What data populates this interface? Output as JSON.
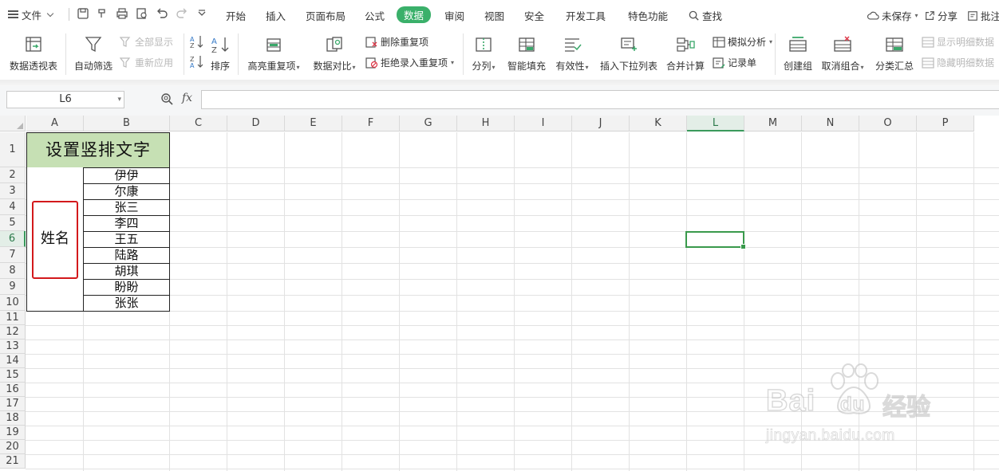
{
  "menu": {
    "file_label": "文件",
    "tabs": [
      "开始",
      "插入",
      "页面布局",
      "公式",
      "数据",
      "审阅",
      "视图",
      "安全",
      "开发工具",
      "特色功能"
    ],
    "active_tab": "数据",
    "search_label": "查找",
    "unsaved_label": "未保存",
    "share_label": "分享",
    "comment_label": "批注"
  },
  "ribbon": {
    "pivot": "数据透视表",
    "autofilter": "自动筛选",
    "show_all": "全部显示",
    "reapply": "重新应用",
    "sort": "排序",
    "highlight_dup": "高亮重复项",
    "compare": "数据对比",
    "delete_dup": "删除重复项",
    "reject_dup": "拒绝录入重复项",
    "split": "分列",
    "smart_fill": "智能填充",
    "validity": "有效性",
    "insert_dropdown": "插入下拉列表",
    "consolidate": "合并计算",
    "simulate": "模拟分析",
    "record_form": "记录单",
    "create_group": "创建组",
    "ungroup": "取消组合",
    "subtotal": "分类汇总",
    "show_detail": "显示明细数据",
    "hide_detail": "隐藏明细数据"
  },
  "formula_bar": {
    "name_box": "L6",
    "fx": "fx",
    "content": ""
  },
  "sheet": {
    "columns": [
      "A",
      "B",
      "C",
      "D",
      "E",
      "F",
      "G",
      "H",
      "I",
      "J",
      "K",
      "L",
      "M",
      "N",
      "O",
      "P"
    ],
    "rows": [
      "1",
      "2",
      "3",
      "4",
      "5",
      "6",
      "7",
      "8",
      "9",
      "10",
      "11",
      "12",
      "13",
      "14",
      "15",
      "16",
      "17",
      "18",
      "19",
      "20",
      "21"
    ],
    "selected_column": "L",
    "selected_row": "6",
    "title": "设置竖排文字",
    "merged_label": "姓名",
    "names": [
      "伊伊",
      "尔康",
      "张三",
      "李四",
      "王五",
      "陆路",
      "胡琪",
      "盼盼",
      "张张"
    ],
    "title_fill": "#c6e0b4",
    "highlight_color": "#d3191c",
    "accent": "#3ab06a"
  },
  "watermark": {
    "brand": "Bai",
    "brand_suffix": "du",
    "brand_cn": "经验",
    "url": "jingyan.baidu.com"
  }
}
